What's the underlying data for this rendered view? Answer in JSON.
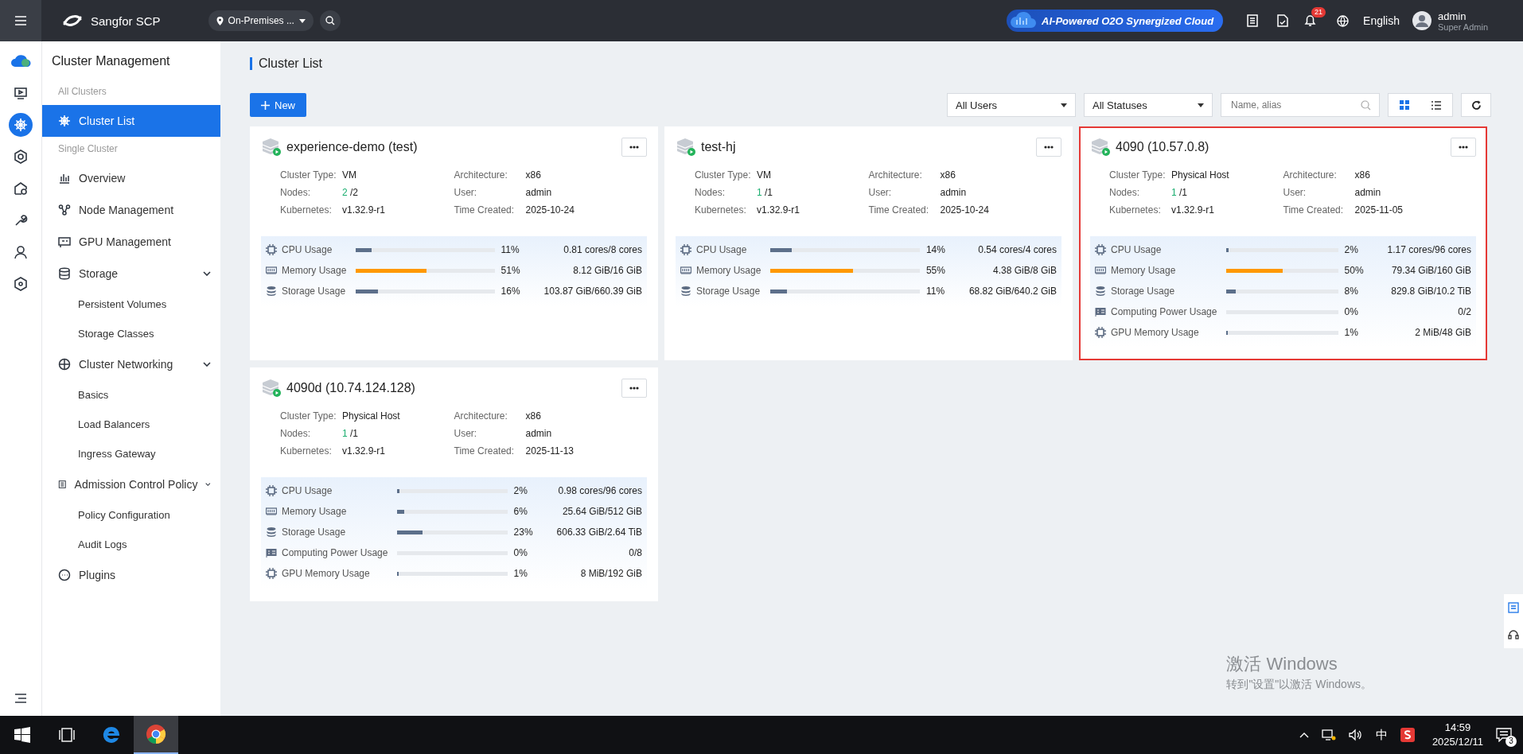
{
  "topbar": {
    "product": "Sangfor SCP",
    "location": "On-Premises ...",
    "banner": "AI-Powered O2O Synergized Cloud",
    "notification_count": "21",
    "language": "English",
    "user": "admin",
    "role": "Super Admin"
  },
  "rail": [
    {
      "kind": "monitor",
      "selected": false
    },
    {
      "kind": "cluster",
      "selected": true
    },
    {
      "kind": "hex",
      "selected": false
    },
    {
      "kind": "home",
      "selected": false
    },
    {
      "kind": "wrench",
      "selected": false
    },
    {
      "kind": "user",
      "selected": false
    },
    {
      "kind": "gear",
      "selected": false
    }
  ],
  "sidebar": {
    "title": "Cluster Management",
    "groups": [
      {
        "heading": "All Clusters",
        "items": [
          {
            "label": "Cluster List",
            "kind": "cluster",
            "selected": true
          }
        ]
      },
      {
        "heading": "Single Cluster",
        "items": [
          {
            "label": "Overview",
            "kind": "chart",
            "selected": false
          },
          {
            "label": "Node Management",
            "kind": "nodes",
            "selected": false
          },
          {
            "label": "GPU Management",
            "kind": "gpu",
            "selected": false
          },
          {
            "label": "Storage",
            "kind": "storage",
            "selected": false,
            "expanded": true,
            "children": [
              {
                "label": "Persistent Volumes",
                "selected": false
              },
              {
                "label": "Storage Classes",
                "selected": false
              }
            ]
          },
          {
            "label": "Cluster Networking",
            "kind": "globe",
            "selected": false,
            "expanded": true,
            "children": [
              {
                "label": "Basics",
                "selected": false
              },
              {
                "label": "Load Balancers",
                "selected": false
              },
              {
                "label": "Ingress Gateway",
                "selected": false
              }
            ]
          },
          {
            "label": "Admission Control Policy",
            "kind": "doc",
            "selected": false,
            "expanded": true,
            "children": [
              {
                "label": "Policy Configuration",
                "selected": false
              },
              {
                "label": "Audit Logs",
                "selected": false
              }
            ]
          },
          {
            "label": "Plugins",
            "kind": "dots",
            "selected": false
          }
        ]
      }
    ]
  },
  "page": {
    "title": "Cluster List",
    "new_button": "New",
    "user_filter": "All Users",
    "status_filter": "All Statuses",
    "search": {
      "placeholder": "Name, alias"
    },
    "views": [
      {
        "kind": "grid",
        "selected": true
      },
      {
        "kind": "list",
        "selected": false
      }
    ]
  },
  "clusters": [
    {
      "name": "experience-demo (test)",
      "highlighted": false,
      "cluster_type": "VM",
      "nodes_ready": "2",
      "nodes_total": "/2",
      "kubernetes": "v1.32.9-r1",
      "architecture": "x86",
      "user": "admin",
      "time_created": "2025-10-24",
      "labels": {
        "cluster_type": "Cluster Type:",
        "nodes": "Nodes:",
        "kubernetes": "Kubernetes:",
        "architecture": "Architecture:",
        "user": "User:",
        "time_created": "Time Created:"
      },
      "metrics": [
        {
          "kind": "cpu",
          "label": "CPU Usage",
          "level": 0.11,
          "percent": "11%",
          "reading": "0.81 cores/8 cores"
        },
        {
          "kind": "memory",
          "label": "Memory Usage",
          "level": 0.51,
          "percent": "51%",
          "reading": "8.12 GiB/16 GiB"
        },
        {
          "kind": "storage",
          "label": "Storage Usage",
          "level": 0.16,
          "percent": "16%",
          "reading": "103.87 GiB/660.39 GiB"
        }
      ]
    },
    {
      "name": "test-hj",
      "highlighted": false,
      "cluster_type": "VM",
      "nodes_ready": "1",
      "nodes_total": "/1",
      "kubernetes": "v1.32.9-r1",
      "architecture": "x86",
      "user": "admin",
      "time_created": "2025-10-24",
      "labels": {
        "cluster_type": "Cluster Type:",
        "nodes": "Nodes:",
        "kubernetes": "Kubernetes:",
        "architecture": "Architecture:",
        "user": "User:",
        "time_created": "Time Created:"
      },
      "metrics": [
        {
          "kind": "cpu",
          "label": "CPU Usage",
          "level": 0.14,
          "percent": "14%",
          "reading": "0.54 cores/4 cores"
        },
        {
          "kind": "memory",
          "label": "Memory Usage",
          "level": 0.55,
          "percent": "55%",
          "reading": "4.38 GiB/8 GiB"
        },
        {
          "kind": "storage",
          "label": "Storage Usage",
          "level": 0.11,
          "percent": "11%",
          "reading": "68.82 GiB/640.2 GiB"
        }
      ]
    },
    {
      "name": "4090 (10.57.0.8)",
      "highlighted": true,
      "cluster_type": "Physical Host",
      "nodes_ready": "1",
      "nodes_total": "/1",
      "kubernetes": "v1.32.9-r1",
      "architecture": "x86",
      "user": "admin",
      "time_created": "2025-11-05",
      "labels": {
        "cluster_type": "Cluster Type:",
        "nodes": "Nodes:",
        "kubernetes": "Kubernetes:",
        "architecture": "Architecture:",
        "user": "User:",
        "time_created": "Time Created:"
      },
      "metrics": [
        {
          "kind": "cpu",
          "label": "CPU Usage",
          "level": 0.02,
          "percent": "2%",
          "reading": "1.17 cores/96 cores"
        },
        {
          "kind": "memory",
          "label": "Memory Usage",
          "level": 0.5,
          "percent": "50%",
          "reading": "79.34 GiB/160 GiB"
        },
        {
          "kind": "storage",
          "label": "Storage Usage",
          "level": 0.08,
          "percent": "8%",
          "reading": "829.8 GiB/10.2 TiB"
        },
        {
          "kind": "compute",
          "label": "Computing Power Usage",
          "level": 0,
          "percent": "0%",
          "reading": "0/2"
        },
        {
          "kind": "cpu",
          "label": "GPU Memory Usage",
          "level": 0.01,
          "percent": "1%",
          "reading": "2 MiB/48 GiB"
        }
      ]
    },
    {
      "name": "4090d (10.74.124.128)",
      "highlighted": false,
      "cluster_type": "Physical Host",
      "nodes_ready": "1",
      "nodes_total": "/1",
      "kubernetes": "v1.32.9-r1",
      "architecture": "x86",
      "user": "admin",
      "time_created": "2025-11-13",
      "labels": {
        "cluster_type": "Cluster Type:",
        "nodes": "Nodes:",
        "kubernetes": "Kubernetes:",
        "architecture": "Architecture:",
        "user": "User:",
        "time_created": "Time Created:"
      },
      "metrics": [
        {
          "kind": "cpu",
          "label": "CPU Usage",
          "level": 0.02,
          "percent": "2%",
          "reading": "0.98 cores/96 cores"
        },
        {
          "kind": "memory",
          "label": "Memory Usage",
          "level": 0.06,
          "percent": "6%",
          "reading": "25.64 GiB/512 GiB"
        },
        {
          "kind": "storage",
          "label": "Storage Usage",
          "level": 0.23,
          "percent": "23%",
          "reading": "606.33 GiB/2.64 TiB"
        },
        {
          "kind": "compute",
          "label": "Computing Power Usage",
          "level": 0,
          "percent": "0%",
          "reading": "0/8"
        },
        {
          "kind": "cpu",
          "label": "GPU Memory Usage",
          "level": 0.01,
          "percent": "1%",
          "reading": "8 MiB/192 GiB"
        }
      ]
    }
  ],
  "activation_notice": {
    "title": "激活 Windows",
    "text": "转到\"设置\"以激活 Windows。"
  },
  "taskbar": {
    "apps": [
      {
        "kind": "start",
        "selected": false
      },
      {
        "kind": "taskview",
        "selected": false
      },
      {
        "kind": "edge",
        "selected": false
      },
      {
        "kind": "chrome",
        "selected": true
      }
    ],
    "ime": "中",
    "time": "14:59",
    "date": "2025/12/11",
    "notification_count": "3"
  }
}
